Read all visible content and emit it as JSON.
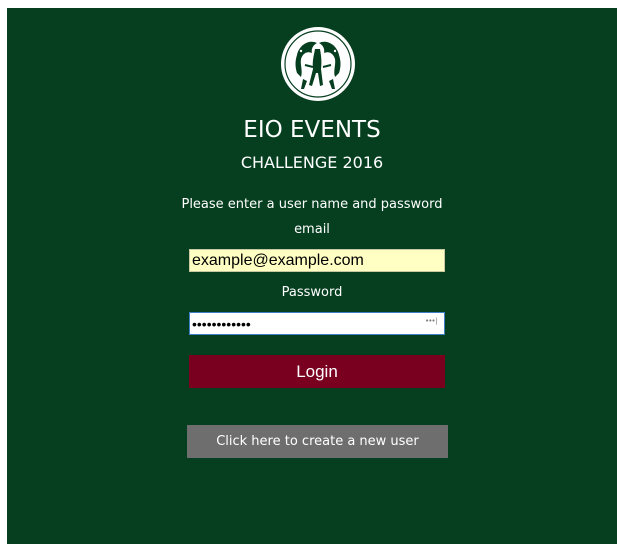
{
  "header": {
    "logo_icon": "greek-horses-emblem-icon",
    "title": "EIO EVENTS",
    "subtitle": "CHALLENGE 2016"
  },
  "form": {
    "instruction": "Please enter a user name and password",
    "email_label": "email",
    "email_value": "example@example.com",
    "password_label": "Password",
    "password_value": "••••••••••••",
    "login_label": "Login",
    "create_user_label": "Click here to create a new user"
  },
  "colors": {
    "background": "#063f20",
    "login_button": "#7a0020",
    "create_user_button": "#6e6e6e",
    "email_autofill": "#ffffc4",
    "focus_border": "#3c7fc4"
  }
}
